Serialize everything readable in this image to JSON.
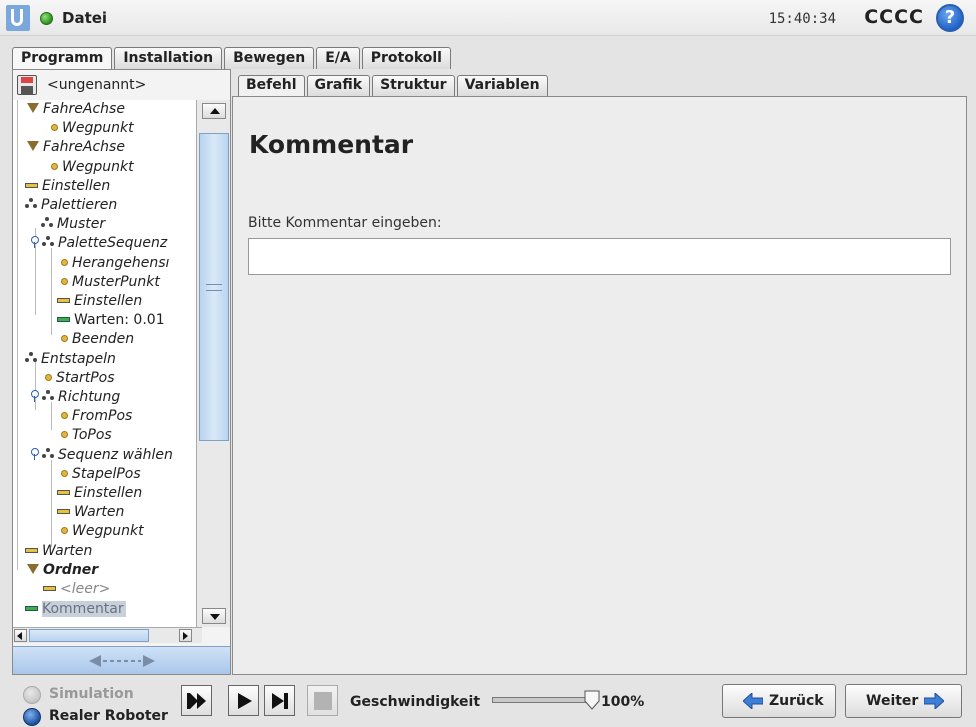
{
  "header": {
    "file_menu": "Datei",
    "time": "15:40:34",
    "robot_name": "CCCC",
    "help": "?",
    "colors": {
      "status": "#3aa52a",
      "accent": "#1e5fc6"
    }
  },
  "main_tabs": [
    {
      "label": "Programm",
      "active": true
    },
    {
      "label": "Installation",
      "active": false
    },
    {
      "label": "Bewegen",
      "active": false
    },
    {
      "label": "E/A",
      "active": false
    },
    {
      "label": "Protokoll",
      "active": false
    }
  ],
  "program": {
    "name": "<ungenannt>"
  },
  "tree": [
    {
      "label": "FahreAchse",
      "icon": "folder-icon"
    },
    {
      "label": "Wegpunkt",
      "icon": "waypoint-icon"
    },
    {
      "label": "FahreAchse",
      "icon": "folder-icon"
    },
    {
      "label": "Wegpunkt",
      "icon": "waypoint-icon"
    },
    {
      "label": "Einstellen",
      "icon": "set-icon"
    },
    {
      "label": "Palettieren",
      "icon": "pallet-icon"
    },
    {
      "label": "Muster",
      "icon": "pallet-icon"
    },
    {
      "label": "PaletteSequenz",
      "icon": "pallet-icon"
    },
    {
      "label": "Herangehensı",
      "icon": "waypoint-icon"
    },
    {
      "label": "MusterPunkt",
      "icon": "waypoint-icon"
    },
    {
      "label": "Einstellen",
      "icon": "set-icon"
    },
    {
      "label": "Warten: 0.01",
      "icon": "wait-icon"
    },
    {
      "label": "Beenden",
      "icon": "waypoint-icon"
    },
    {
      "label": "Entstapeln",
      "icon": "pallet-icon"
    },
    {
      "label": "StartPos",
      "icon": "waypoint-icon"
    },
    {
      "label": "Richtung",
      "icon": "pallet-icon"
    },
    {
      "label": "FromPos",
      "icon": "waypoint-icon"
    },
    {
      "label": "ToPos",
      "icon": "waypoint-icon"
    },
    {
      "label": "Sequenz wählen",
      "icon": "pallet-icon"
    },
    {
      "label": "StapelPos",
      "icon": "waypoint-icon"
    },
    {
      "label": "Einstellen",
      "icon": "set-icon"
    },
    {
      "label": "Warten",
      "icon": "set-icon"
    },
    {
      "label": "Wegpunkt",
      "icon": "waypoint-icon"
    },
    {
      "label": "Warten",
      "icon": "set-icon"
    },
    {
      "label": "Ordner",
      "icon": "folder-icon"
    },
    {
      "label": "<leer>",
      "icon": "set-icon"
    },
    {
      "label": "Kommentar",
      "icon": "comment-icon"
    }
  ],
  "sub_tabs": [
    {
      "label": "Befehl",
      "active": true
    },
    {
      "label": "Grafik",
      "active": false
    },
    {
      "label": "Struktur",
      "active": false
    },
    {
      "label": "Variablen",
      "active": false
    }
  ],
  "content": {
    "title": "Kommentar",
    "comment_label": "Bitte Kommentar eingeben:",
    "comment_value": ""
  },
  "footer": {
    "mode_simulation": "Simulation",
    "mode_real": "Realer Roboter",
    "speed_label": "Geschwindigkeit",
    "speed_value": "100%",
    "speed_fraction": 1.0,
    "back": "Zurück",
    "next": "Weiter"
  }
}
